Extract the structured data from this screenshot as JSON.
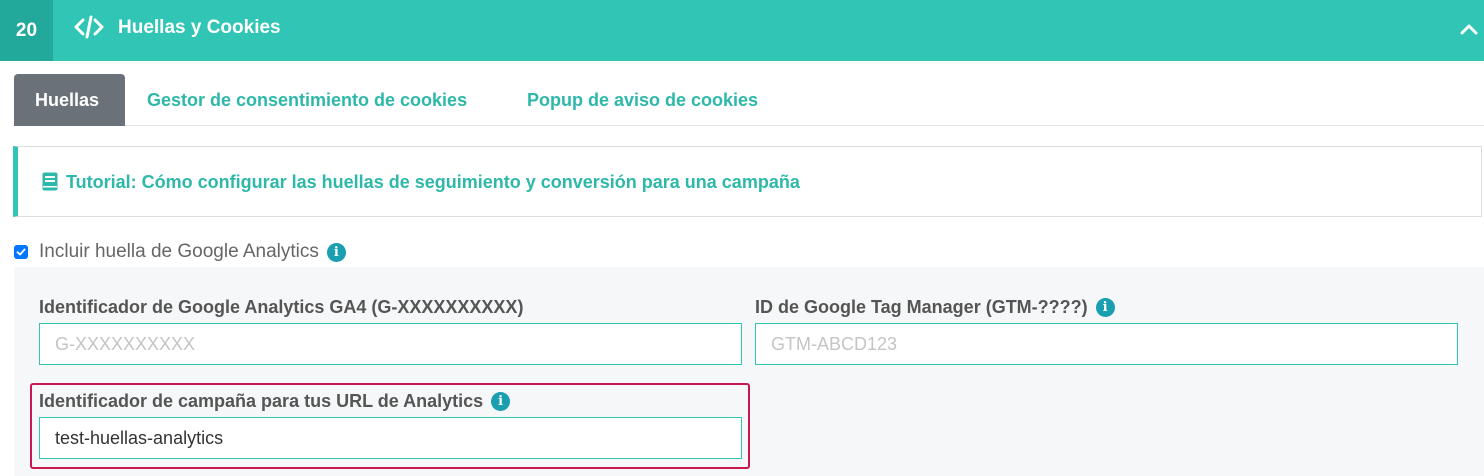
{
  "section": {
    "step_number": "20",
    "title": "Huellas y Cookies",
    "header_color": "#30c5b5",
    "step_color": "#23a99b"
  },
  "tabs": [
    {
      "label": "Huellas",
      "active": true
    },
    {
      "label": "Gestor de consentimiento de cookies",
      "active": false
    },
    {
      "label": "Popup de aviso de cookies",
      "active": false
    }
  ],
  "tutorial": {
    "icon": "book-icon",
    "label": "Tutorial: Cómo configurar las huellas de seguimiento y conversión para una campaña"
  },
  "analytics": {
    "include_label": "Incluir huella de Google Analytics",
    "include_checked": true,
    "ga4": {
      "label": "Identificador de Google Analytics GA4 (G-XXXXXXXXXX)",
      "placeholder": "G-XXXXXXXXXX",
      "value": ""
    },
    "gtm": {
      "label": "ID de Google Tag Manager (GTM-????)",
      "placeholder": "GTM-ABCD123",
      "value": ""
    },
    "campaign": {
      "label": "Identificador de campaña para tus URL de Analytics",
      "value": "test-huellas-analytics"
    }
  },
  "colors": {
    "accent": "#30c5b5",
    "tab_active_bg": "#6b7178",
    "info": "#1a9fb0",
    "highlight": "#c7194f"
  }
}
